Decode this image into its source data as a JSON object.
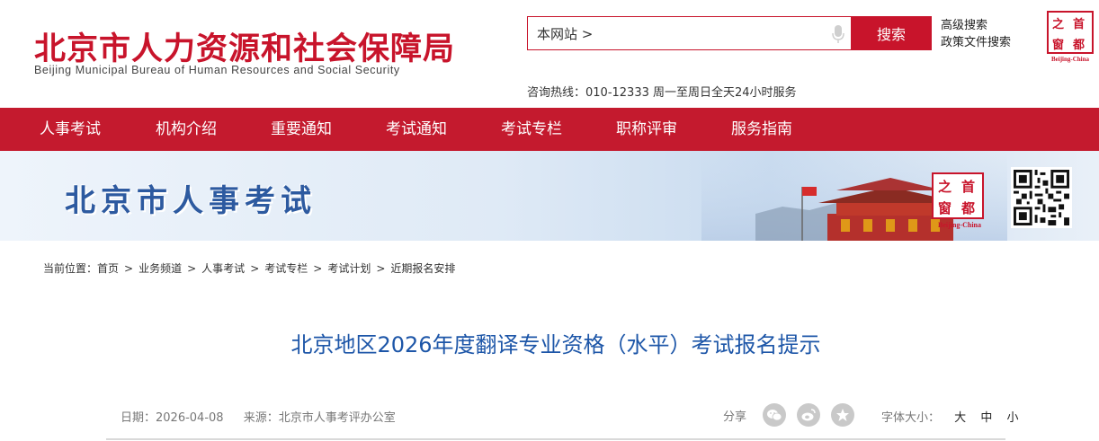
{
  "header": {
    "logo_cn": "北京市人力资源和社会保障局",
    "logo_en": "Beijing Municipal Bureau of Human Resources and Social Security",
    "search": {
      "scope_value": "本网站 >",
      "button": "搜索"
    },
    "advanced_search": "高级搜索",
    "policy_search": "政策文件搜索",
    "hotline": "咨询热线：010-12333 周一至周日全天24小时服务",
    "seal": {
      "chars": [
        "之",
        "首",
        "窗",
        "都"
      ],
      "caption": "Beijing-China"
    }
  },
  "nav": {
    "items": [
      {
        "label": "人事考试"
      },
      {
        "label": "机构介绍"
      },
      {
        "label": "重要通知"
      },
      {
        "label": "考试通知"
      },
      {
        "label": "考试专栏"
      },
      {
        "label": "职称评审"
      },
      {
        "label": "服务指南"
      }
    ]
  },
  "banner": {
    "title": "北京市人事考试",
    "seal": {
      "chars": [
        "之",
        "首",
        "窗",
        "都"
      ],
      "caption": "Beijing-China"
    }
  },
  "breadcrumb": {
    "prefix": "当前位置：",
    "items": [
      "首页",
      "业务频道",
      "人事考试",
      "考试专栏",
      "考试计划",
      "近期报名安排"
    ],
    "separator": ">"
  },
  "article": {
    "title": "北京地区2026年度翻译专业资格（水平）考试报名提示",
    "date_label": "日期：",
    "date": "2026-04-08",
    "source_label": "来源：",
    "source": "北京市人事考评办公室",
    "share_label": "分享",
    "share_icons": [
      "wechat-icon",
      "weibo-icon",
      "favorite-star-icon"
    ],
    "font_size_label": "字体大小：",
    "font_sizes": [
      "大",
      "中",
      "小"
    ]
  },
  "colors": {
    "brand_red": "#c8142b",
    "nav_red": "#c41a2e",
    "title_blue": "#1d56a8",
    "banner_blue": "#2d5aa0"
  }
}
